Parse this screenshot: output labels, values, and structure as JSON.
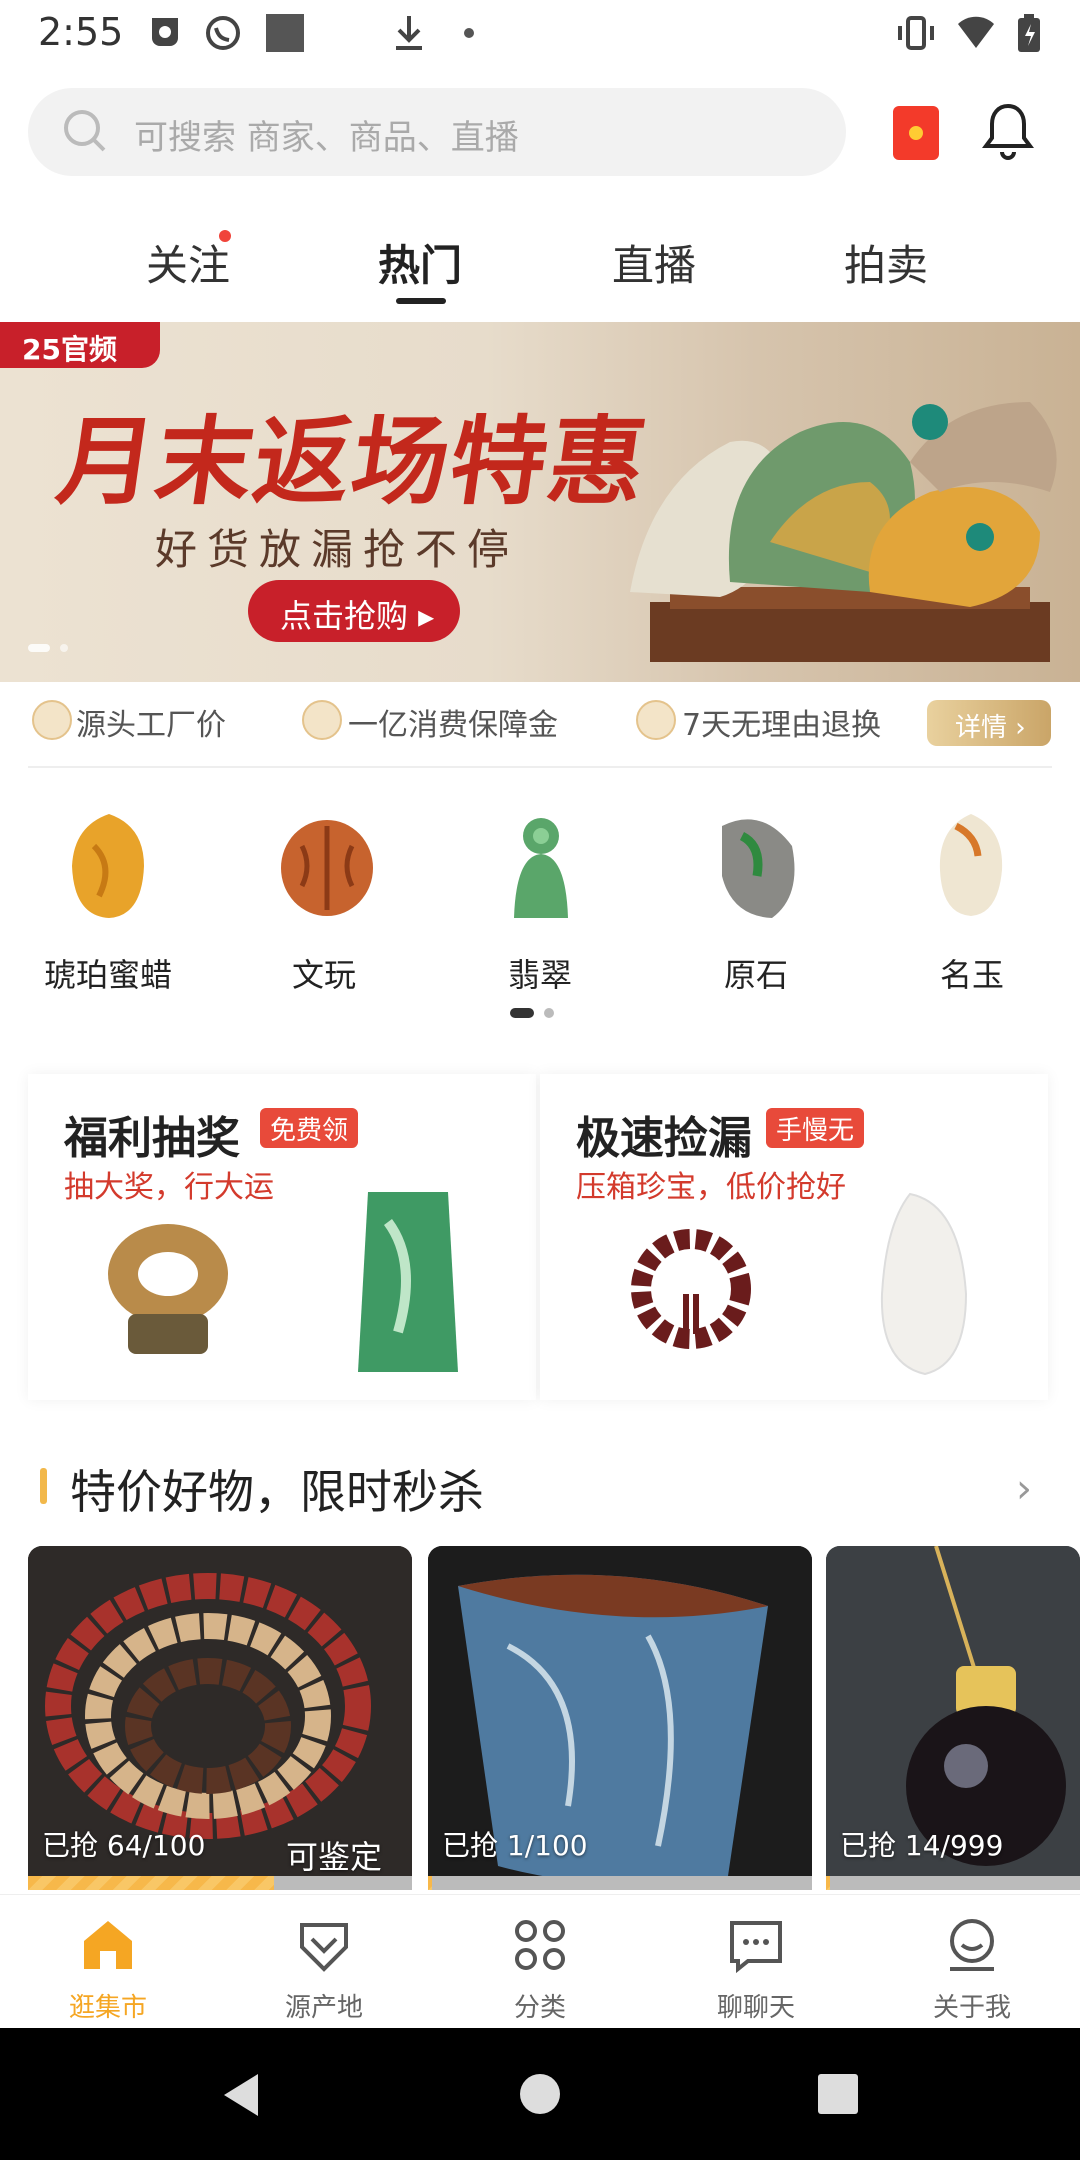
{
  "status": {
    "time": "2:55"
  },
  "search": {
    "placeholder": "可搜索 商家、商品、直播"
  },
  "tabs": [
    {
      "label": "关注"
    },
    {
      "label": "热门"
    },
    {
      "label": "直播"
    },
    {
      "label": "拍卖"
    }
  ],
  "banner": {
    "tag": "25官频",
    "headline": "月末返场特惠",
    "subline": "好货放漏抢不停",
    "cta": "点击抢购 ▸"
  },
  "guarantees": [
    {
      "label": "源头工厂价"
    },
    {
      "label": "一亿消费保障金"
    },
    {
      "label": "7天无理由退换"
    }
  ],
  "guarantee_detail": "详情 ›",
  "categories": [
    {
      "label": "琥珀蜜蜡",
      "color": "#e8a32a"
    },
    {
      "label": "文玩",
      "color": "#c7632e"
    },
    {
      "label": "翡翠",
      "color": "#5aa66a"
    },
    {
      "label": "原石",
      "color": "#8a8a86"
    },
    {
      "label": "名玉",
      "color": "#efe6d2"
    }
  ],
  "promos": [
    {
      "title": "福利抽奖",
      "badge": "免费领",
      "slogan": "抽大奖，行大运"
    },
    {
      "title": "极速捡漏",
      "badge": "手慢无",
      "slogan": "压箱珍宝，低价抢好"
    }
  ],
  "section": {
    "title": "特价好物，限时秒杀",
    "arrow": "›"
  },
  "products": [
    {
      "sold": "已抢 64/100",
      "extra": "可鉴定",
      "progress": 0.64
    },
    {
      "sold": "已抢 1/100",
      "extra": "",
      "progress": 0.01
    },
    {
      "sold": "已抢 14/999",
      "extra": "",
      "progress": 0.014
    }
  ],
  "bottom_nav": [
    {
      "label": "逛集市",
      "active": true
    },
    {
      "label": "源产地"
    },
    {
      "label": "分类"
    },
    {
      "label": "聊聊天"
    },
    {
      "label": "关于我"
    }
  ],
  "colors": {
    "accent": "#f5a623",
    "red": "#c8202a"
  }
}
